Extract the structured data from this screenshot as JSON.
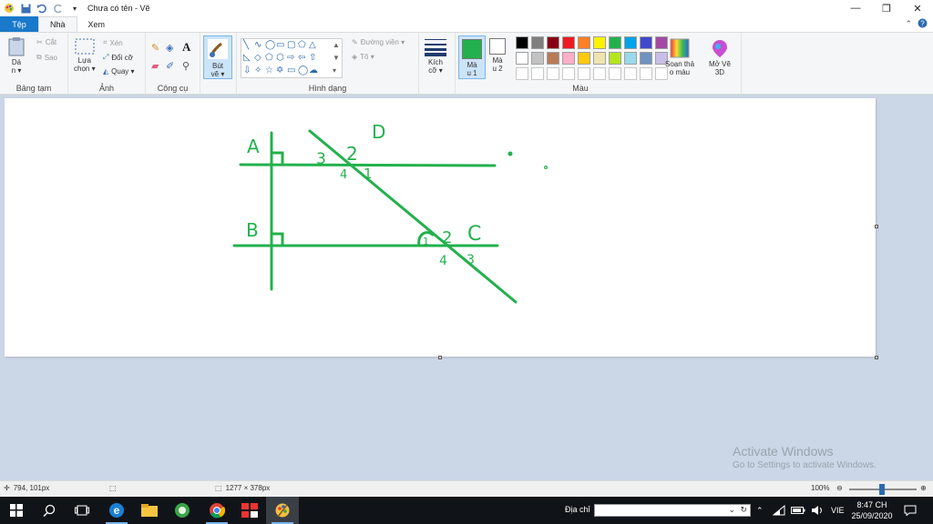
{
  "window": {
    "title": "Chưa có tên - Vẽ"
  },
  "tabs": [
    {
      "label": "Tệp"
    },
    {
      "label": "Nhà"
    },
    {
      "label": "Xem"
    }
  ],
  "ribbon": {
    "clipboard": {
      "label": "Bảng tạm",
      "paste": "Dá\nn ▾",
      "cut": "Cắt",
      "copy": "Sao"
    },
    "image": {
      "label": "Ảnh",
      "select": "Lựa\nchọn ▾",
      "crop": "Xén",
      "resize": "Đổi cỡ",
      "rotate": "Quay ▾"
    },
    "tools": {
      "label": "Công cụ"
    },
    "brushes": {
      "label": "Bút\nvẽ ▾"
    },
    "shapes": {
      "label": "Hình dạng",
      "outline": "Đường viền ▾",
      "fill": "Tô ▾"
    },
    "size": {
      "label": "Kích\ncỡ ▾"
    },
    "color1": {
      "label": "Mà\nu 1",
      "value": "#22b14c"
    },
    "color2": {
      "label": "Mà\nu 2",
      "value": "#ffffff"
    },
    "colors": {
      "label": "Màu",
      "row1": [
        "#000000",
        "#7f7f7f",
        "#880015",
        "#ed1c24",
        "#ff7f27",
        "#fff200",
        "#22b14c",
        "#00a2e8",
        "#3f48cc",
        "#a349a4"
      ],
      "row2": [
        "#ffffff",
        "#c3c3c3",
        "#b97a57",
        "#ffaec9",
        "#ffc90e",
        "#efe4b0",
        "#b5e61d",
        "#99d9ea",
        "#7092be",
        "#c8bfe7"
      ],
      "row3": [
        "#ffffff",
        "#ffffff",
        "#ffffff",
        "#ffffff",
        "#ffffff",
        "#ffffff",
        "#ffffff",
        "#ffffff",
        "#ffffff",
        "#ffffff"
      ]
    },
    "edit_colors": {
      "label": "Soạn thả\no màu"
    },
    "paint3d": {
      "label": "Mở Vẽ\n3D"
    }
  },
  "drawing": {
    "stroke_color": "#22b14c",
    "labels": [
      {
        "text": "A"
      },
      {
        "text": "B"
      },
      {
        "text": "D"
      },
      {
        "text": "C"
      },
      {
        "text": "3"
      },
      {
        "text": "2"
      },
      {
        "text": "4"
      },
      {
        "text": "1"
      },
      {
        "text": "1"
      },
      {
        "text": "2"
      },
      {
        "text": "4"
      },
      {
        "text": "3"
      }
    ]
  },
  "watermark": {
    "title": "Activate Windows",
    "subtitle": "Go to Settings to activate Windows."
  },
  "status": {
    "cursor": "794, 101px",
    "canvas_size": "1277 × 378px",
    "zoom": "100%"
  },
  "taskbar": {
    "address_label": "Địa chỉ",
    "language": "VIE",
    "time": "8:47 CH",
    "date": "25/09/2020"
  }
}
